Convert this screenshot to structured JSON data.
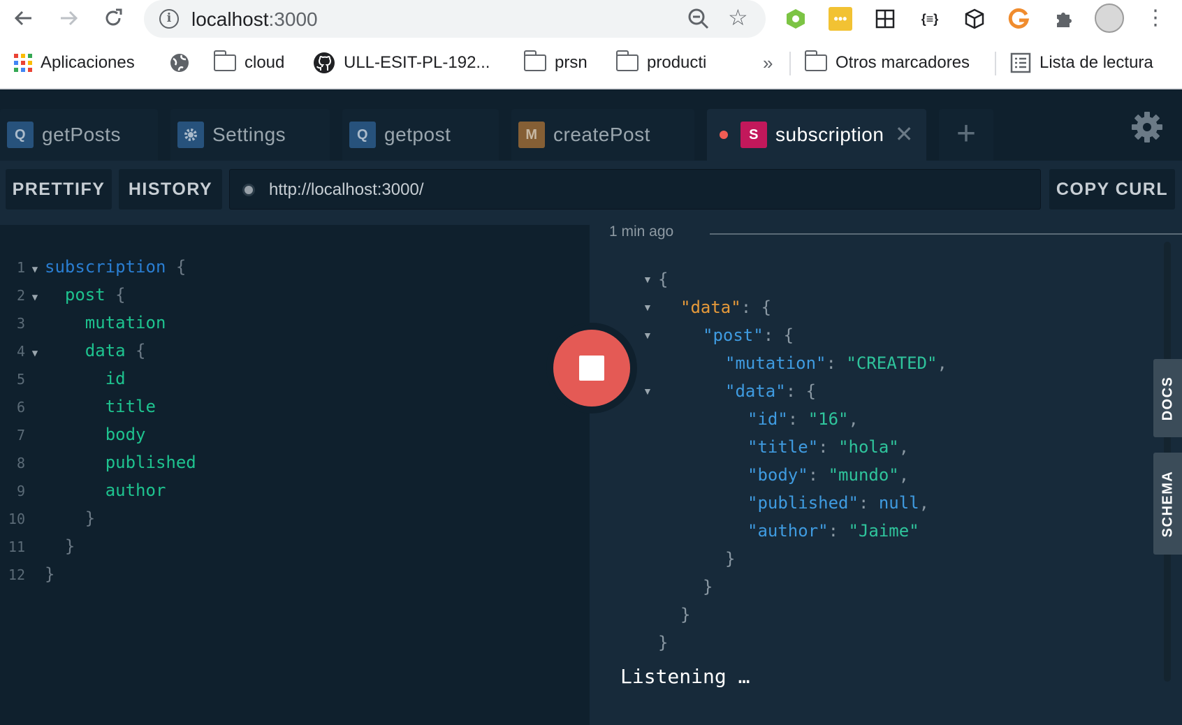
{
  "browser": {
    "address": {
      "host": "localhost",
      "port": ":3000"
    },
    "bookmarks": [
      {
        "label": "Aplicaciones",
        "icon": "apps-grid-icon"
      },
      {
        "label": "",
        "icon": "globe-icon"
      },
      {
        "label": "cloud",
        "icon": "folder-icon"
      },
      {
        "label": "ULL-ESIT-PL-192...",
        "icon": "github-icon"
      },
      {
        "label": "prsn",
        "icon": "folder-icon"
      },
      {
        "label": "producti",
        "icon": "folder-icon"
      }
    ],
    "overflow": "»",
    "other_bookmarks": "Otros marcadores",
    "reading_list": "Lista de lectura"
  },
  "tabs": [
    {
      "badge": "Q",
      "label": "getPosts"
    },
    {
      "badge": "⚙",
      "label": "Settings"
    },
    {
      "badge": "Q",
      "label": "getpost"
    },
    {
      "badge": "M",
      "label": "createPost"
    },
    {
      "badge": "S",
      "label": "subscription",
      "active": true
    }
  ],
  "toolbar": {
    "prettify": "PRETTIFY",
    "history": "HISTORY",
    "endpoint": "http://localhost:3000/",
    "copy_curl": "COPY CURL"
  },
  "editor": {
    "lines": [
      "1",
      "2",
      "3",
      "4",
      "5",
      "6",
      "7",
      "8",
      "9",
      "10",
      "11",
      "12"
    ]
  },
  "query": {
    "subscription": "subscription",
    "post": "post",
    "mutation": "mutation",
    "data": "data",
    "id": "id",
    "title": "title",
    "body": "body",
    "published": "published",
    "author": "author"
  },
  "result": {
    "time": "1 min ago",
    "keys": {
      "data": "\"data\"",
      "post": "\"post\"",
      "mutation": "\"mutation\"",
      "data2": "\"data\"",
      "id": "\"id\"",
      "title": "\"title\"",
      "body": "\"body\"",
      "published": "\"published\"",
      "author": "\"author\""
    },
    "values": {
      "mutation": "\"CREATED\"",
      "id": "\"16\"",
      "title": "\"hola\"",
      "body": "\"mundo\"",
      "published": "null",
      "author": "\"Jaime\""
    },
    "status": "Listening …"
  },
  "side_tabs": {
    "docs": "DOCS",
    "schema": "SCHEMA"
  },
  "colors": {
    "stop_button": "#e45a55",
    "active_tab_dot": "#f25c54",
    "subscription_badge": "#c2185b"
  }
}
